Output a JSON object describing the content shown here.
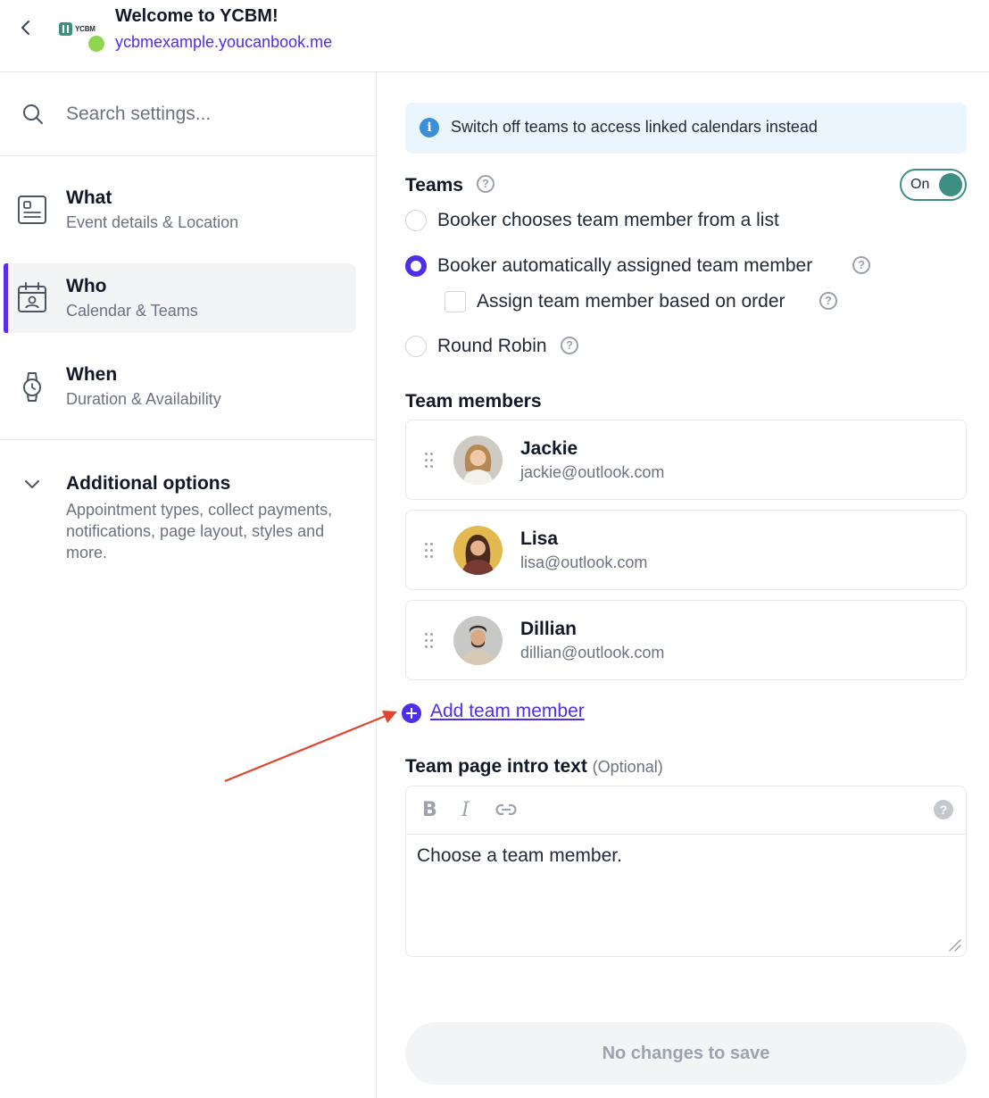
{
  "header": {
    "title": "Welcome to YCBM!",
    "url": "ycbmexample.youcanbook.me",
    "logo_text": "YCBM",
    "status_color": "#8fd64f"
  },
  "sidebar": {
    "search_placeholder": "Search settings...",
    "items": [
      {
        "title": "What",
        "subtitle": "Event details & Location",
        "icon": "document-icon",
        "active": false
      },
      {
        "title": "Who",
        "subtitle": "Calendar & Teams",
        "icon": "calendar-user-icon",
        "active": true
      },
      {
        "title": "When",
        "subtitle": "Duration & Availability",
        "icon": "watch-icon",
        "active": false
      }
    ],
    "additional": {
      "title": "Additional options",
      "description": "Appointment types, collect payments, notifications, page layout, styles and more."
    }
  },
  "main": {
    "banner_text": "Switch off teams to access linked calendars instead",
    "teams_label": "Teams",
    "toggle_label": "On",
    "options": {
      "list": "Booker chooses team member from a list",
      "auto": "Booker automatically assigned team member",
      "order": "Assign team member based on order",
      "round_robin": "Round Robin"
    },
    "members_label": "Team members",
    "members": [
      {
        "name": "Jackie",
        "email": "jackie@outlook.com"
      },
      {
        "name": "Lisa",
        "email": "lisa@outlook.com"
      },
      {
        "name": "Dillian",
        "email": "dillian@outlook.com"
      }
    ],
    "add_member": "Add team member",
    "intro_label": "Team page intro text",
    "intro_optional": "(Optional)",
    "editor_bold": "B",
    "editor_italic": "I",
    "editor_help": "?",
    "editor_text": "Choose a team member.",
    "save_label": "No changes to save"
  },
  "colors": {
    "accent": "#4f2ee8",
    "toggle": "#3d8f83",
    "banner_bg": "#eaf5fd",
    "annotation_arrow": "#e2452f"
  }
}
